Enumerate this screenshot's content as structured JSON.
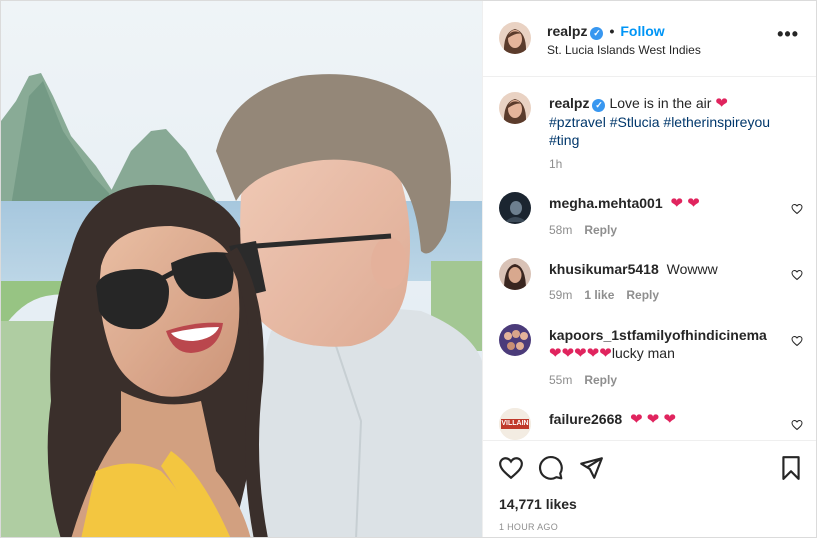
{
  "post": {
    "username": "realpz",
    "follow_label": "Follow",
    "separator": "•",
    "location": "St. Lucia Islands West Indies",
    "more_label": "•••",
    "caption": {
      "username": "realpz",
      "text": "Love is in the air",
      "heart": "❤",
      "hashtags": [
        "#pztravel",
        "#Stlucia",
        "#letherinspireyou",
        "#ting"
      ],
      "time": "1h"
    },
    "likes": "14,771 likes",
    "posted": "1 HOUR AGO"
  },
  "comments": [
    {
      "username": "megha.mehta001",
      "text": "",
      "hearts": "❤ ❤",
      "time": "58m",
      "likes": "",
      "reply": "Reply"
    },
    {
      "username": "khusikumar5418",
      "text": "Wowww",
      "hearts": "",
      "time": "59m",
      "likes": "1 like",
      "reply": "Reply"
    },
    {
      "username": "kapoors_1stfamilyofhindicinema",
      "text": "lucky man",
      "hearts": "❤❤❤❤❤",
      "time": "55m",
      "likes": "",
      "reply": "Reply"
    },
    {
      "username": "failure2668",
      "text": "",
      "hearts": "❤ ❤ ❤",
      "time": "",
      "likes": "",
      "reply": ""
    }
  ],
  "avatar_badge_text": "VILLAIN",
  "colors": {
    "link": "#0095f6",
    "hashtag": "#00376b",
    "heart": "#e0245e",
    "verified": "#3897f0",
    "muted": "#8e8e8e"
  },
  "icons": [
    "verified-badge-icon",
    "more-options-icon",
    "heart-icon",
    "comment-icon",
    "share-icon",
    "bookmark-icon"
  ]
}
